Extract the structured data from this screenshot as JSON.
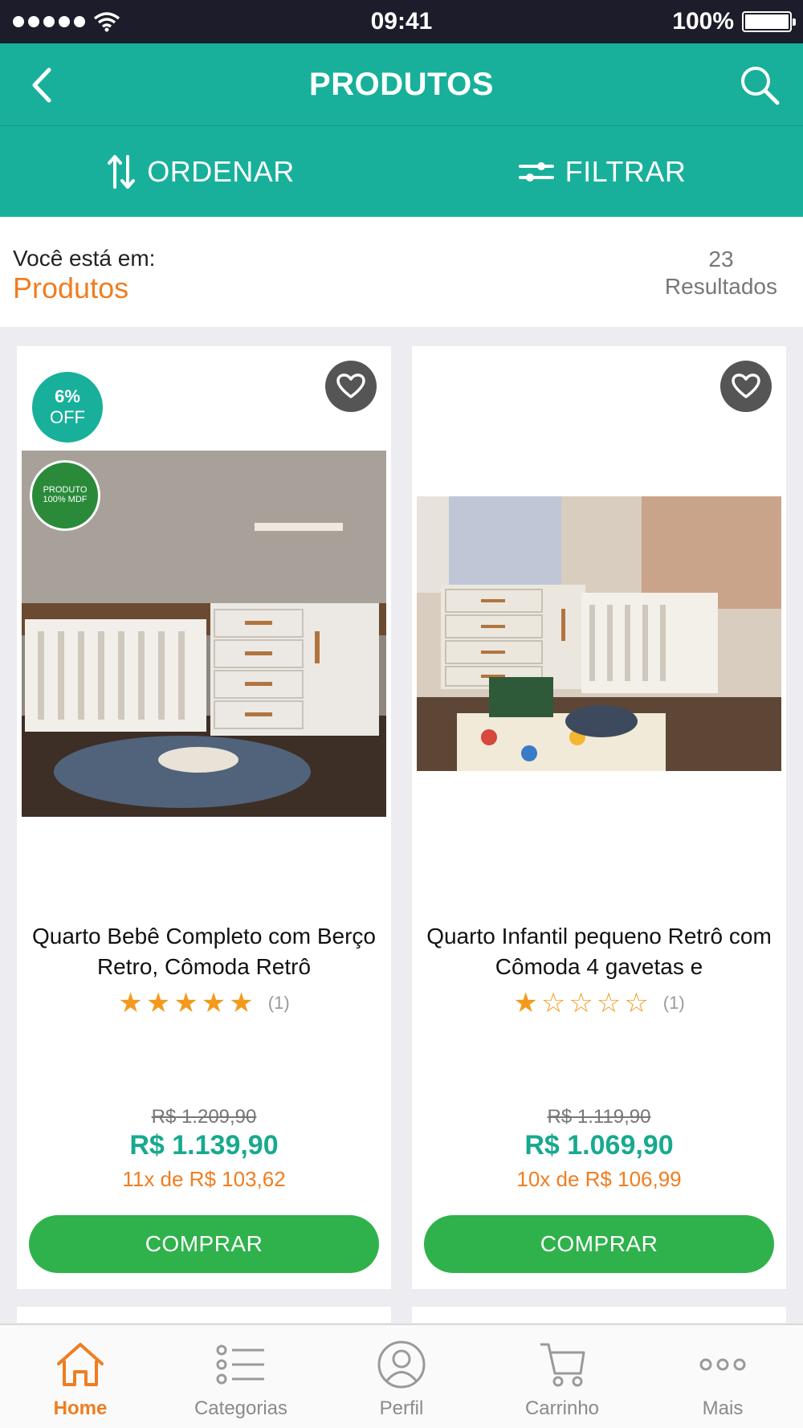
{
  "status_bar": {
    "time": "09:41",
    "battery": "100%"
  },
  "header": {
    "title": "PRODUTOS"
  },
  "actions": {
    "sort_label": "ORDENAR",
    "filter_label": "FILTRAR"
  },
  "breadcrumb": {
    "label": "Você está em:",
    "current": "Produtos",
    "count": "23",
    "count_label": "Resultados"
  },
  "products": [
    {
      "discount_pct": "6%",
      "discount_label": "OFF",
      "seal_text": "PRODUTO 100% MDF",
      "name": "Quarto Bebê Completo com Berço Retro, Cômoda Retrô",
      "rating": 5,
      "rating_count": "(1)",
      "old_price": "R$ 1.209,90",
      "price": "R$ 1.139,90",
      "installments": "11x de R$ 103,62",
      "buy_label": "COMPRAR"
    },
    {
      "name": "Quarto Infantil pequeno Retrô com Cômoda 4 gavetas  e",
      "rating": 1,
      "rating_count": "(1)",
      "old_price": "R$ 1.119,90",
      "price": "R$ 1.069,90",
      "installments": "10x de R$ 106,99",
      "buy_label": "COMPRAR"
    }
  ],
  "tabbar": {
    "items": [
      {
        "label": "Home",
        "icon": "home-icon",
        "active": true
      },
      {
        "label": "Categorias",
        "icon": "list-icon",
        "active": false
      },
      {
        "label": "Perfil",
        "icon": "user-icon",
        "active": false
      },
      {
        "label": "Carrinho",
        "icon": "cart-icon",
        "active": false
      },
      {
        "label": "Mais",
        "icon": "more-icon",
        "active": false
      }
    ]
  },
  "colors": {
    "primary": "#18b09b",
    "accent": "#f07d20",
    "buy": "#2fb24b",
    "star": "#f39a1c"
  }
}
